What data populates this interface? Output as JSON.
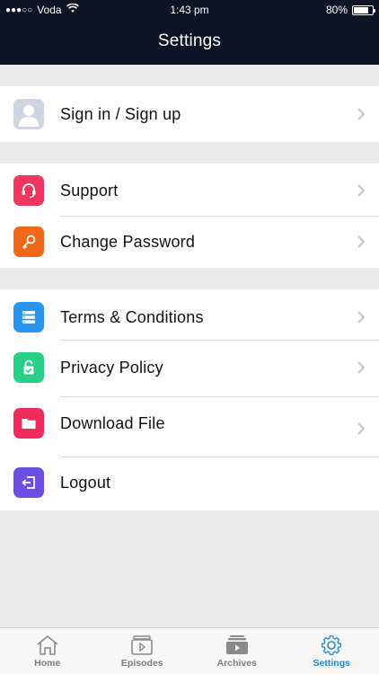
{
  "status_bar": {
    "signal_dots": "●●●○○",
    "carrier": "Voda",
    "time": "1:43 pm",
    "battery_text": "80%",
    "battery_level": 0.8
  },
  "header": {
    "title": "Settings"
  },
  "groups": [
    {
      "items": [
        {
          "label": "Sign in / Sign up",
          "icon": "user-placeholder-icon",
          "color": "#cdd5e3"
        }
      ]
    },
    {
      "items": [
        {
          "label": "Support",
          "icon": "headset-icon",
          "color": "#f0355f"
        },
        {
          "label": "Change Password",
          "icon": "key-icon",
          "color": "#f0681a"
        }
      ]
    },
    {
      "items": [
        {
          "label": "Terms & Conditions",
          "icon": "list-icon",
          "color": "#2a95ef"
        },
        {
          "label": "Privacy Policy",
          "icon": "lock-check-icon",
          "color": "#27cf87"
        },
        {
          "label": "Download File",
          "icon": "folder-icon",
          "color": "#ef2c5c"
        },
        {
          "label": "Logout",
          "icon": "logout-icon",
          "color": "#6b4fe0"
        }
      ]
    }
  ],
  "tabbar": {
    "tabs": [
      {
        "label": "Home",
        "icon": "home-icon",
        "active": false
      },
      {
        "label": "Episodes",
        "icon": "episodes-icon",
        "active": false
      },
      {
        "label": "Archives",
        "icon": "archives-icon",
        "active": false
      },
      {
        "label": "Settings",
        "icon": "gear-icon",
        "active": true
      }
    ],
    "active_color": "#1f87d8",
    "inactive_color": "#7d7d7d"
  }
}
